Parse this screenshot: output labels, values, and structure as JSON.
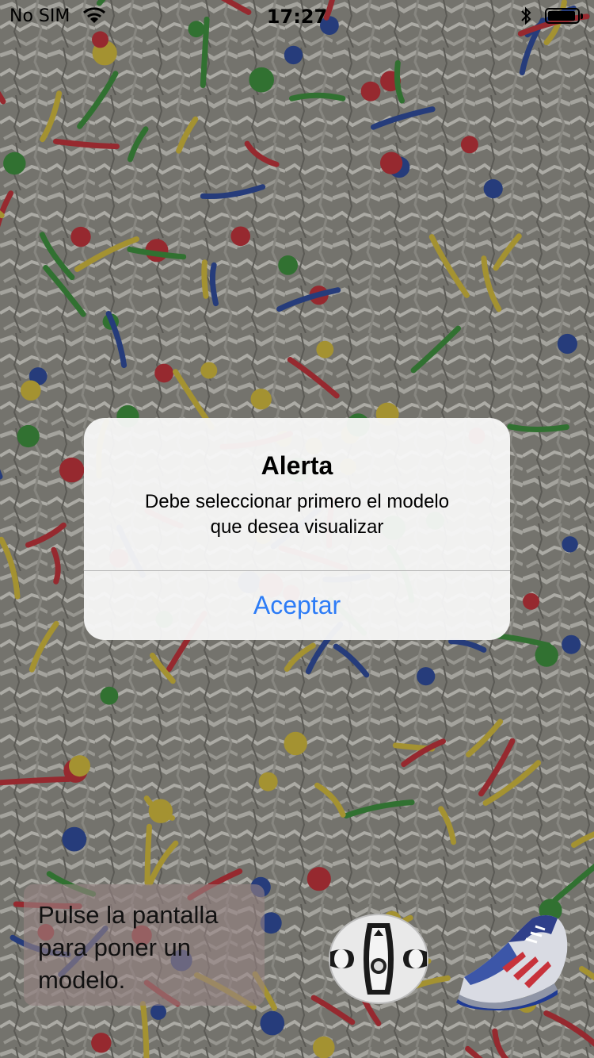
{
  "status_bar": {
    "carrier": "No SIM",
    "time": "17:27",
    "battery_level": 0.95
  },
  "alert": {
    "title": "Alerta",
    "message_line1": "Debe seleccionar primero el modelo",
    "message_line2": "que desea visualizar",
    "button_label": "Aceptar"
  },
  "hint": {
    "line1": "Pulse la pantalla",
    "line2": "para poner un",
    "line3": "modelo."
  },
  "models": [
    {
      "icon": "soccer-ball-icon",
      "brand": "adidas"
    },
    {
      "icon": "sneaker-icon"
    }
  ],
  "colors": {
    "accent": "#2d7cf6",
    "carpet": "#8b8b85"
  }
}
